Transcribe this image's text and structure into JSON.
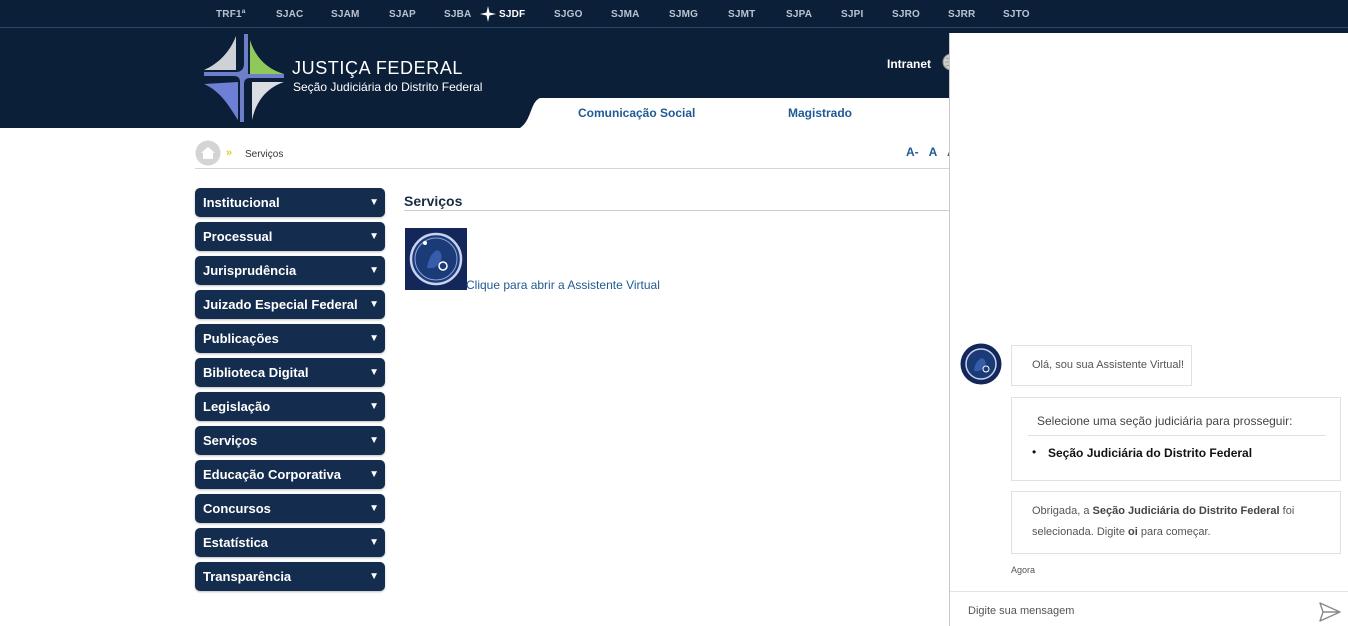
{
  "topbar": {
    "secoes": [
      "TRF1ª",
      "SJAC",
      "SJAM",
      "SJAP",
      "SJBA",
      "SJDF",
      "SJGO",
      "SJMA",
      "SJMG",
      "SJMT",
      "SJPA",
      "SJPI",
      "SJRO",
      "SJRR",
      "SJTO"
    ],
    "active": "SJDF"
  },
  "header": {
    "title": "JUSTIÇA FEDERAL",
    "subtitle": "Seção Judiciária do Distrito Federal",
    "intranet": "Intranet",
    "nav": [
      "Comunicação Social",
      "Magistrado"
    ]
  },
  "breadcrumb": {
    "arrows": "»",
    "current": "Serviços",
    "font_controls": [
      "A-",
      "A",
      "A"
    ]
  },
  "sidebar": {
    "items": [
      {
        "label": "Institucional"
      },
      {
        "label": "Processual"
      },
      {
        "label": "Jurisprudência"
      },
      {
        "label": "Juizado Especial Federal"
      },
      {
        "label": "Publicações"
      },
      {
        "label": "Biblioteca Digital"
      },
      {
        "label": "Legislação"
      },
      {
        "label": "Serviços"
      },
      {
        "label": "Educação Corporativa"
      },
      {
        "label": "Concursos"
      },
      {
        "label": "Estatística"
      },
      {
        "label": "Transparência"
      }
    ],
    "caret": "▼"
  },
  "main": {
    "title": "Serviços",
    "assistant_link": "Clique para abrir a Assistente Virtual"
  },
  "chat": {
    "greeting": "Olá, sou sua Assistente Virtual!",
    "select_prompt": "Selecione uma seção judiciária para prosseguir:",
    "option": "Seção Judiciária do Distrito Federal",
    "confirm_pre": "Obrigada, a ",
    "confirm_bold": "Seção Judiciária do Distrito Federal",
    "confirm_mid": " foi selecionada. Digite ",
    "confirm_oi": "oi",
    "confirm_post": " para começar.",
    "time": "Agora",
    "input_placeholder": "Digite sua mensagem"
  },
  "colors": {
    "navy": "#0c1f38",
    "menu": "#142c4d",
    "link": "#1f5a94"
  }
}
